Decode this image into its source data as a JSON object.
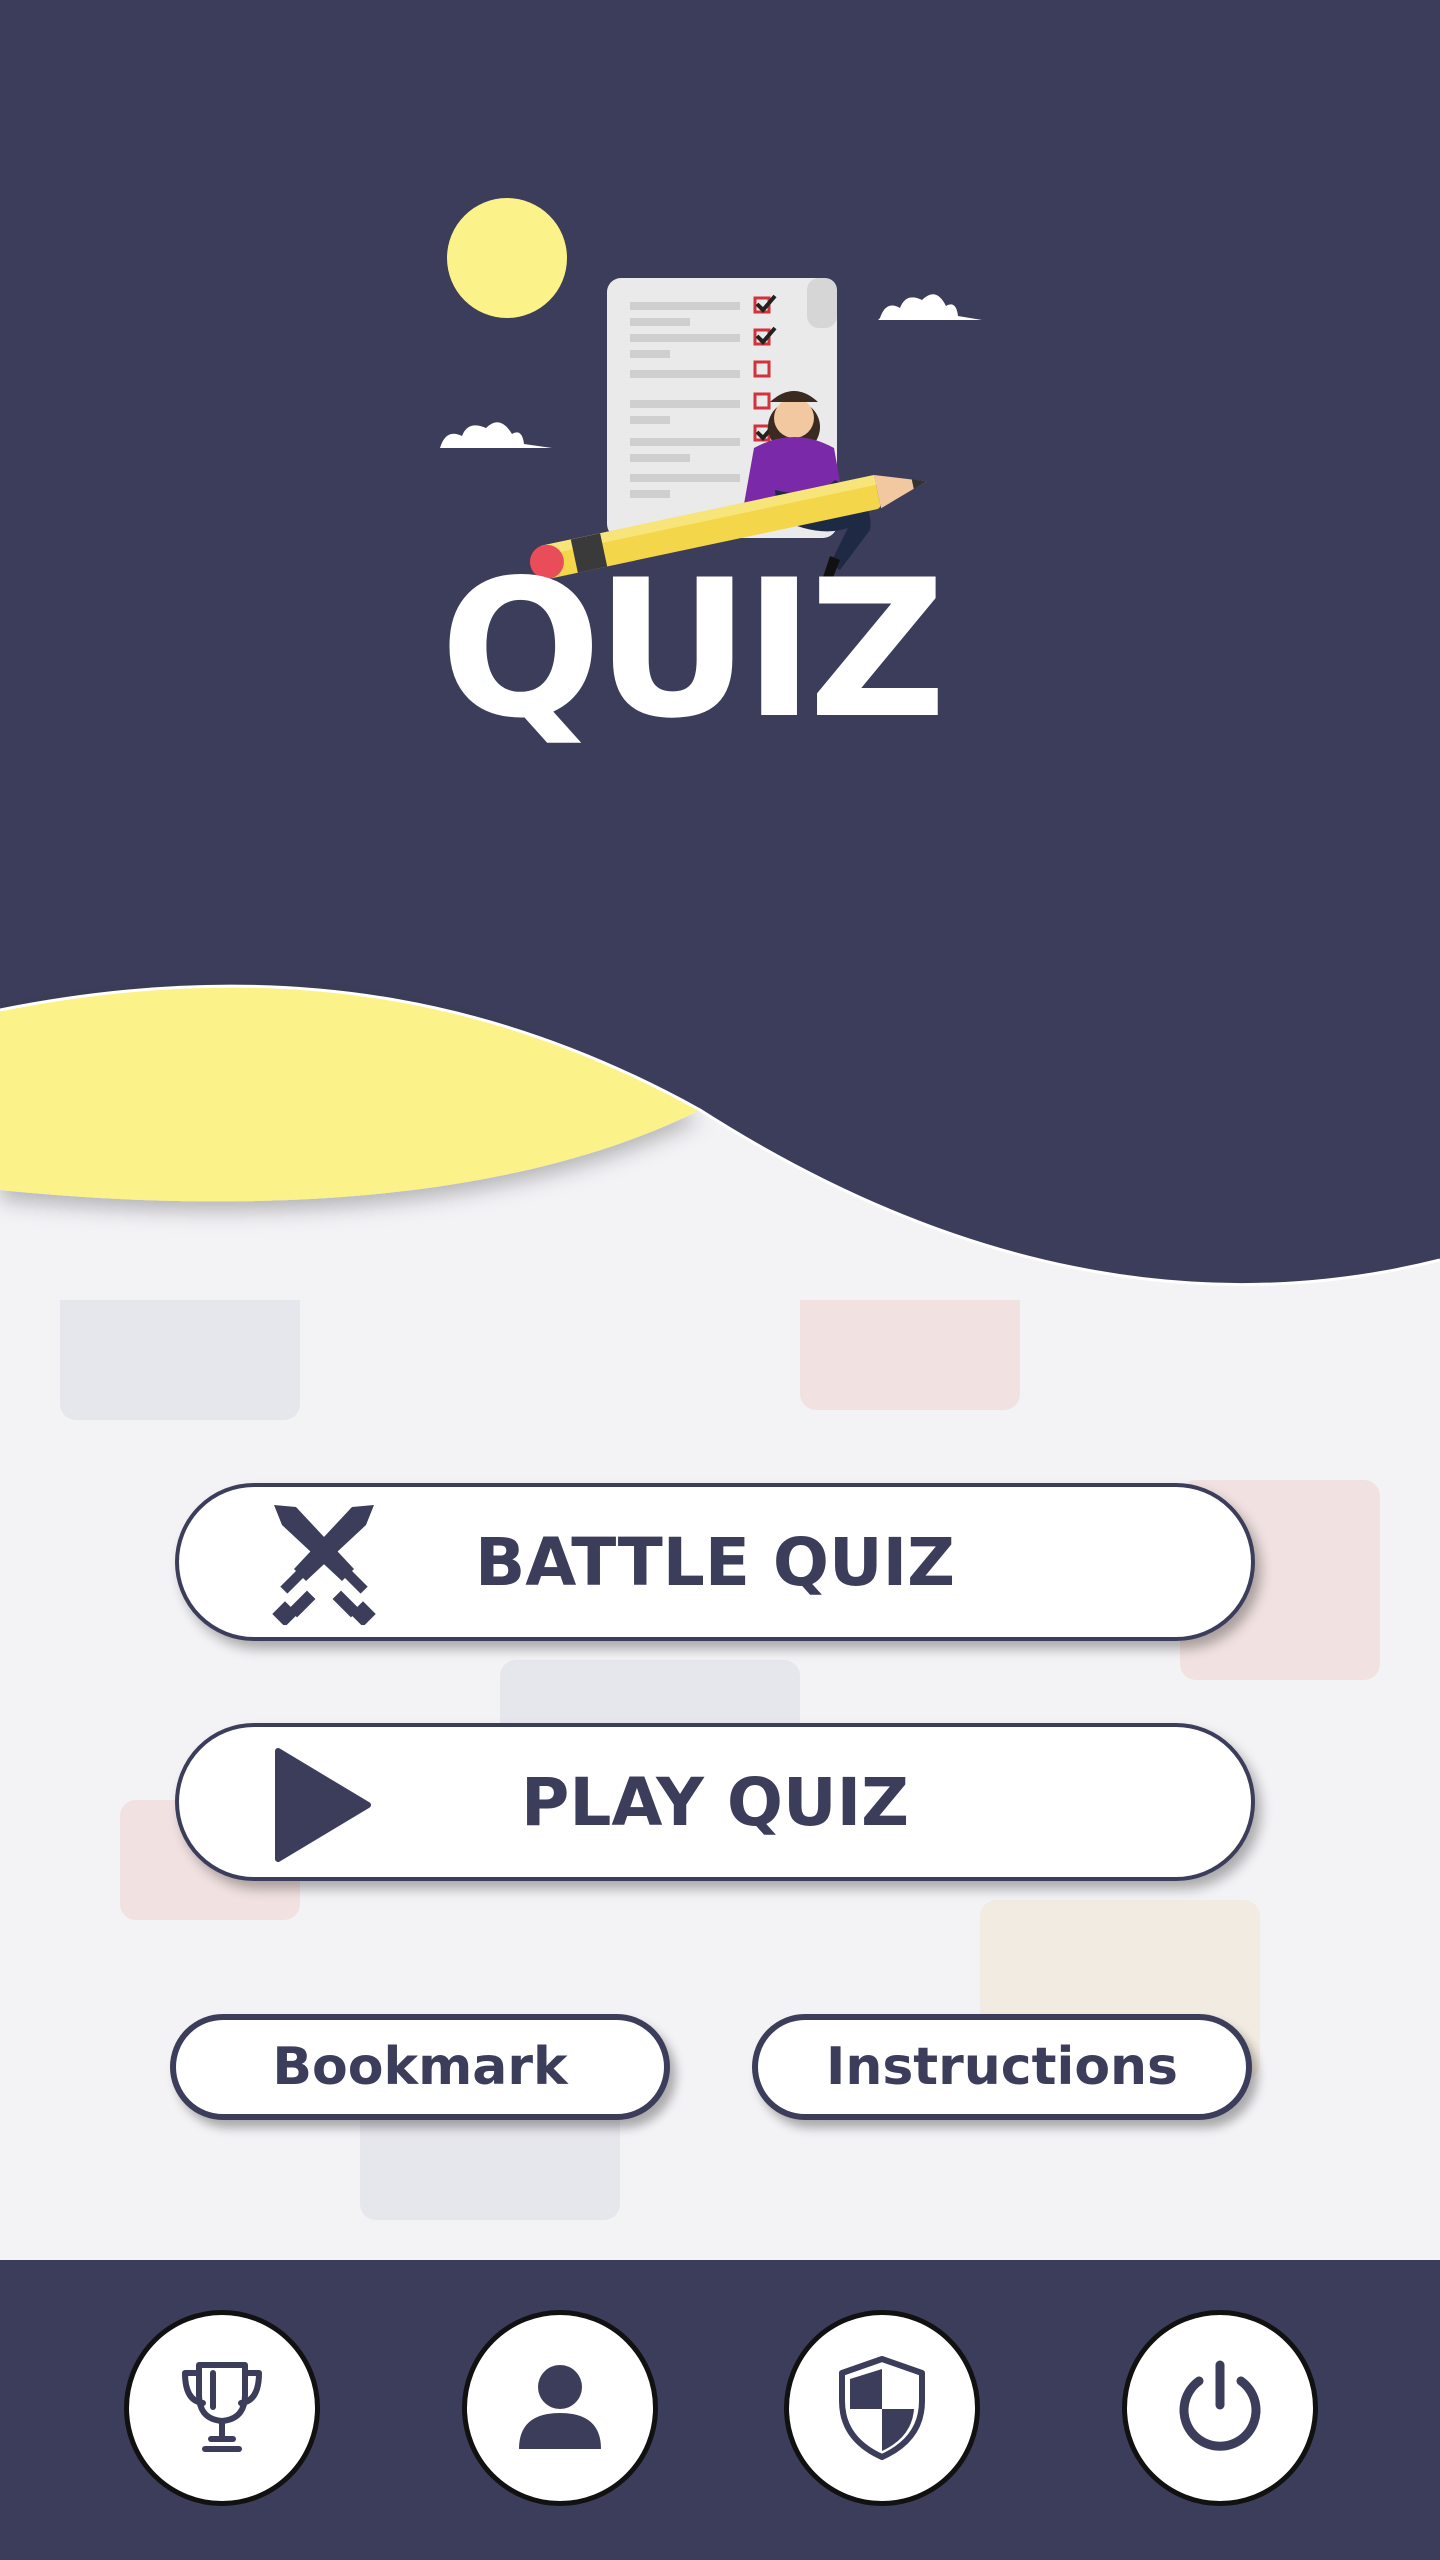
{
  "app": {
    "logo_text": "QUIZ"
  },
  "colors": {
    "primary": "#3b3d5a",
    "accent_yellow": "#fbf28a",
    "background": "#f3f3f6",
    "white": "#ffffff"
  },
  "main": {
    "battle_quiz_label": "BATTLE QUIZ",
    "play_quiz_label": "PLAY QUIZ",
    "bookmark_label": "Bookmark",
    "instructions_label": "Instructions"
  },
  "icons": {
    "battle": "crossed-swords-icon",
    "play": "play-icon",
    "nav": [
      "trophy-icon",
      "user-icon",
      "shield-icon",
      "power-icon"
    ]
  }
}
